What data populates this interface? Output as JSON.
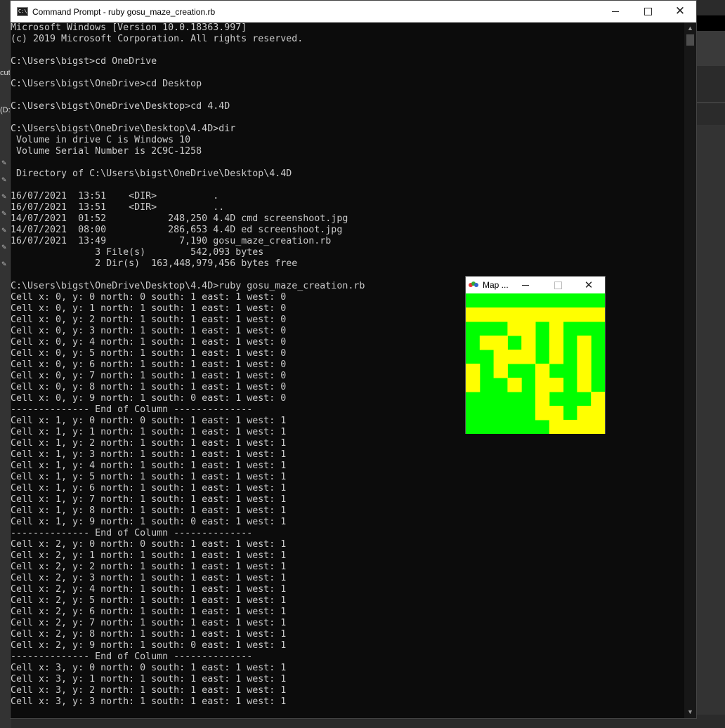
{
  "background": {
    "left_fragment_1": "cut",
    "left_fragment_2": "(D:"
  },
  "window": {
    "title": "Command Prompt - ruby  gosu_maze_creation.rb",
    "icon": "cmd-icon",
    "minimize_icon": "minimize-icon",
    "maximize_icon": "maximize-icon",
    "close_icon": "close-icon"
  },
  "console": {
    "lines": [
      "Microsoft Windows [Version 10.0.18363.997]",
      "(c) 2019 Microsoft Corporation. All rights reserved.",
      "",
      "C:\\Users\\bigst>cd OneDrive",
      "",
      "C:\\Users\\bigst\\OneDrive>cd Desktop",
      "",
      "C:\\Users\\bigst\\OneDrive\\Desktop>cd 4.4D",
      "",
      "C:\\Users\\bigst\\OneDrive\\Desktop\\4.4D>dir",
      " Volume in drive C is Windows 10",
      " Volume Serial Number is 2C9C-1258",
      "",
      " Directory of C:\\Users\\bigst\\OneDrive\\Desktop\\4.4D",
      "",
      "16/07/2021  13:51    <DIR>          .",
      "16/07/2021  13:51    <DIR>          ..",
      "14/07/2021  01:52           248,250 4.4D cmd screenshoot.jpg",
      "14/07/2021  08:00           286,653 4.4D ed screenshoot.jpg",
      "16/07/2021  13:49             7,190 gosu_maze_creation.rb",
      "               3 File(s)        542,093 bytes",
      "               2 Dir(s)  163,448,979,456 bytes free",
      "",
      "C:\\Users\\bigst\\OneDrive\\Desktop\\4.4D>ruby gosu_maze_creation.rb",
      "Cell x: 0, y: 0 north: 0 south: 1 east: 1 west: 0",
      "Cell x: 0, y: 1 north: 1 south: 1 east: 1 west: 0",
      "Cell x: 0, y: 2 north: 1 south: 1 east: 1 west: 0",
      "Cell x: 0, y: 3 north: 1 south: 1 east: 1 west: 0",
      "Cell x: 0, y: 4 north: 1 south: 1 east: 1 west: 0",
      "Cell x: 0, y: 5 north: 1 south: 1 east: 1 west: 0",
      "Cell x: 0, y: 6 north: 1 south: 1 east: 1 west: 0",
      "Cell x: 0, y: 7 north: 1 south: 1 east: 1 west: 0",
      "Cell x: 0, y: 8 north: 1 south: 1 east: 1 west: 0",
      "Cell x: 0, y: 9 north: 1 south: 0 east: 1 west: 0",
      "-------------- End of Column --------------",
      "Cell x: 1, y: 0 north: 0 south: 1 east: 1 west: 1",
      "Cell x: 1, y: 1 north: 1 south: 1 east: 1 west: 1",
      "Cell x: 1, y: 2 north: 1 south: 1 east: 1 west: 1",
      "Cell x: 1, y: 3 north: 1 south: 1 east: 1 west: 1",
      "Cell x: 1, y: 4 north: 1 south: 1 east: 1 west: 1",
      "Cell x: 1, y: 5 north: 1 south: 1 east: 1 west: 1",
      "Cell x: 1, y: 6 north: 1 south: 1 east: 1 west: 1",
      "Cell x: 1, y: 7 north: 1 south: 1 east: 1 west: 1",
      "Cell x: 1, y: 8 north: 1 south: 1 east: 1 west: 1",
      "Cell x: 1, y: 9 north: 1 south: 0 east: 1 west: 1",
      "-------------- End of Column --------------",
      "Cell x: 2, y: 0 north: 0 south: 1 east: 1 west: 1",
      "Cell x: 2, y: 1 north: 1 south: 1 east: 1 west: 1",
      "Cell x: 2, y: 2 north: 1 south: 1 east: 1 west: 1",
      "Cell x: 2, y: 3 north: 1 south: 1 east: 1 west: 1",
      "Cell x: 2, y: 4 north: 1 south: 1 east: 1 west: 1",
      "Cell x: 2, y: 5 north: 1 south: 1 east: 1 west: 1",
      "Cell x: 2, y: 6 north: 1 south: 1 east: 1 west: 1",
      "Cell x: 2, y: 7 north: 1 south: 1 east: 1 west: 1",
      "Cell x: 2, y: 8 north: 1 south: 1 east: 1 west: 1",
      "Cell x: 2, y: 9 north: 1 south: 0 east: 1 west: 1",
      "-------------- End of Column --------------",
      "Cell x: 3, y: 0 north: 0 south: 1 east: 1 west: 1",
      "Cell x: 3, y: 1 north: 1 south: 1 east: 1 west: 1",
      "Cell x: 3, y: 2 north: 1 south: 1 east: 1 west: 1",
      "Cell x: 3, y: 3 north: 1 south: 1 east: 1 west: 1"
    ],
    "text_color": "#cccccc",
    "background_color": "#0c0c0c"
  },
  "scrollbar": {
    "up_icon": "scroll-up-icon",
    "down_icon": "scroll-down-icon"
  },
  "map_window": {
    "title": "Map ...",
    "icon": "gosu-ruby-icon",
    "colors": {
      "path": "#ffff00",
      "wall": "#00ff00"
    },
    "grid": [
      "0000000000",
      "1111111111",
      "0001101000",
      "0110101010",
      "0011101010",
      "1010010010",
      "1001011010",
      "0000010001",
      "0000011011",
      "0000001111"
    ]
  }
}
